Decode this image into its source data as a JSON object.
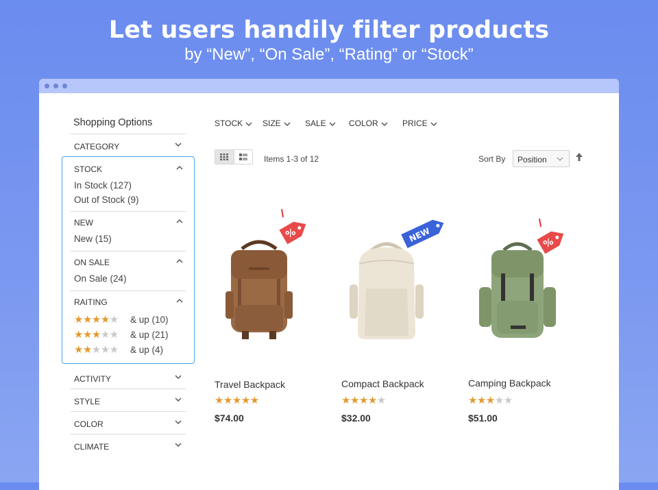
{
  "hero": {
    "title": "Let users handily filter products",
    "subtitle": "by “New”, “On Sale”, “Rating” or “Stock”"
  },
  "sidebar": {
    "title": "Shopping Options",
    "filters_top": [
      {
        "label": "CATEGORY"
      }
    ],
    "stock": {
      "label": "STOCK",
      "options": [
        "In Stock (127)",
        "Out of Stock (9)"
      ]
    },
    "new": {
      "label": "NEW",
      "options": [
        "New (15)"
      ]
    },
    "on_sale": {
      "label": "ON SALE",
      "options": [
        "On Sale (24)"
      ]
    },
    "rating": {
      "label": "RAITING",
      "options": [
        {
          "stars": 4,
          "text": "& up (10)"
        },
        {
          "stars": 3,
          "text": "& up (21)"
        },
        {
          "stars": 2,
          "text": "& up (4)"
        }
      ]
    },
    "filters_bottom": [
      {
        "label": "ACTIVITY"
      },
      {
        "label": "STYLE"
      },
      {
        "label": "COLOR"
      },
      {
        "label": "CLIMATE"
      }
    ]
  },
  "top_filters": [
    "STOCK",
    "SIZE",
    "SALE",
    "COLOR",
    "PRICE"
  ],
  "toolbar": {
    "items_count": "Items 1-3 of 12",
    "sort_label": "Sort By",
    "sort_value": "Position"
  },
  "products": [
    {
      "name": "Travel Backpack",
      "rating": 5,
      "price": "$74.00",
      "badge": "sale-tag-icon",
      "color": "#9a6a45"
    },
    {
      "name": "Compact Backpack",
      "rating": 4,
      "price": "$32.00",
      "badge": "new-tag",
      "badge_text": "NEW",
      "color": "#e6dfcf"
    },
    {
      "name": "Camping Backpack",
      "rating": 3,
      "price": "$51.00",
      "badge": "sale-tag-icon",
      "color": "#8ea47a"
    }
  ],
  "colors": {
    "background": "#6b8cef",
    "titlebar": "#b7c6fb",
    "highlight_border": "#4aa3df",
    "star": "#e39a2f",
    "sale_tag": "#e84a4a",
    "new_tag": "#3a63d9"
  }
}
